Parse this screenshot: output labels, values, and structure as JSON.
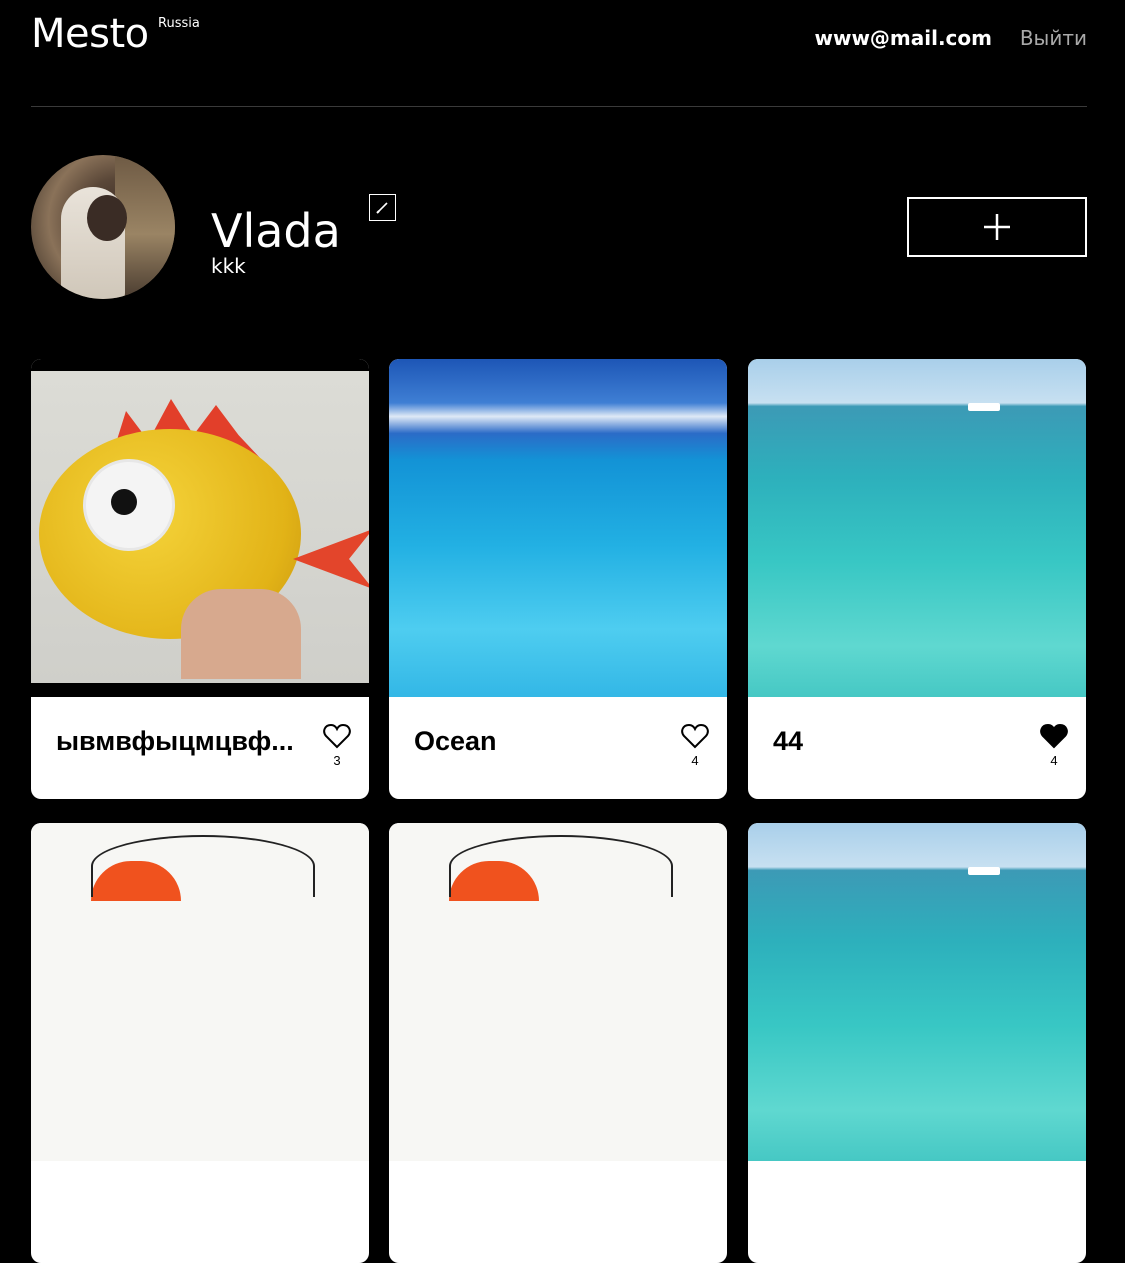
{
  "header": {
    "logo": "Mesto",
    "logo_sup": "Russia",
    "email": "www@mail.com",
    "logout": "Выйти"
  },
  "profile": {
    "name": "Vlada",
    "about": "kkk"
  },
  "cards": [
    {
      "title": "ывмвфыцмцвф...",
      "likes": "3",
      "liked": false
    },
    {
      "title": "Ocean",
      "likes": "4",
      "liked": false
    },
    {
      "title": "44",
      "likes": "4",
      "liked": true
    },
    {
      "title": "",
      "likes": "",
      "liked": false
    },
    {
      "title": "",
      "likes": "",
      "liked": false
    },
    {
      "title": "",
      "likes": "",
      "liked": false
    }
  ],
  "icons": {
    "edit": "pencil-icon",
    "add": "plus-icon",
    "like": "heart-icon"
  },
  "colors": {
    "background": "#000000",
    "card": "#ffffff",
    "muted": "#a9a9a9"
  }
}
